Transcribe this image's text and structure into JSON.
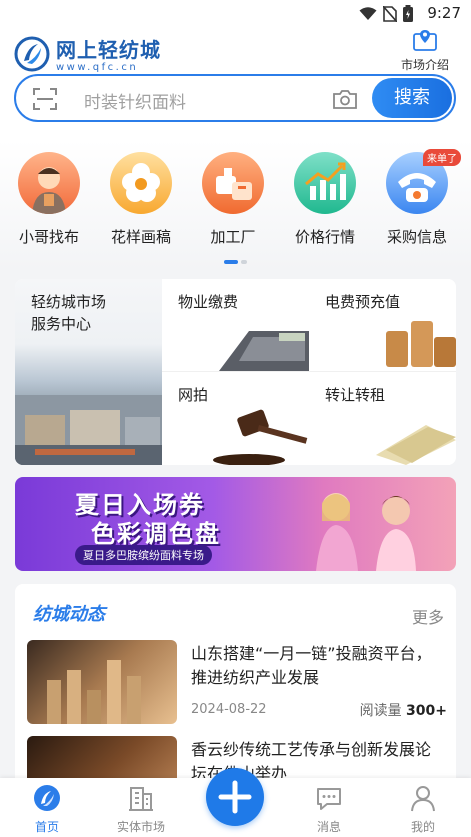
{
  "status_bar": {
    "time": "9:27"
  },
  "header": {
    "app_name": "网上轻纺城",
    "url": "www.qfc.cn",
    "market_intro": "市场介绍"
  },
  "search": {
    "placeholder": "时装针织面料",
    "button": "搜索"
  },
  "quick_nav": [
    {
      "label": "小哥找布"
    },
    {
      "label": "花样画稿"
    },
    {
      "label": "加工厂"
    },
    {
      "label": "价格行情"
    },
    {
      "label": "采购信息",
      "badge": "来单了"
    }
  ],
  "services": {
    "main": "轻纺城市场服务中心",
    "main_line1": "轻纺城市场",
    "main_line2": "服务中心",
    "cells": [
      {
        "label": "物业缴费"
      },
      {
        "label": "电费预充值"
      },
      {
        "label": "网拍"
      },
      {
        "label": "转让转租"
      }
    ]
  },
  "banner": {
    "line1": "夏日入场券",
    "line2": "色彩调色盘",
    "line3": "夏日多巴胺缤纷面料专场"
  },
  "news": {
    "title": "纺城动态",
    "more": "更多",
    "items": [
      {
        "headline": "山东搭建“一月一链”投融资平台，推进纺织产业发展",
        "date": "2024-08-22",
        "reads_label": "阅读量",
        "reads": "300+"
      },
      {
        "headline": "香云纱传统工艺传承与创新发展论坛在佛山举办"
      }
    ]
  },
  "tabbar": [
    {
      "label": "首页",
      "active": true
    },
    {
      "label": "实体市场"
    },
    {
      "label": "消息"
    },
    {
      "label": "我的"
    }
  ],
  "colors": {
    "accent": "#2b7de9",
    "badge": "#e94a3a"
  }
}
